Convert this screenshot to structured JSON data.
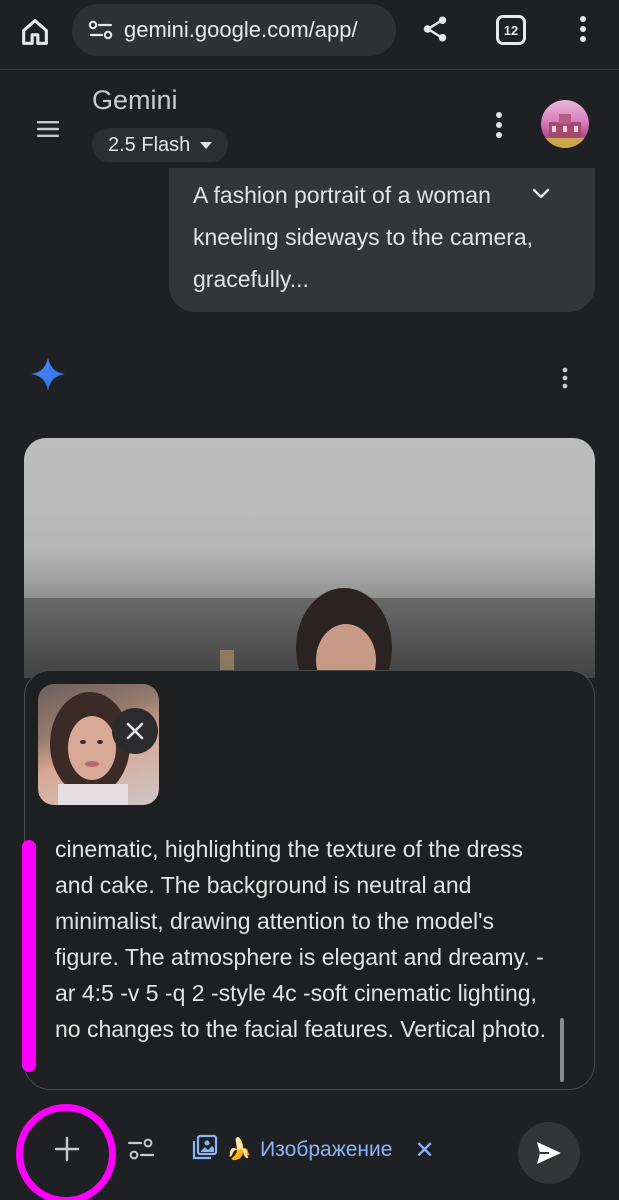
{
  "browser": {
    "url": "gemini.google.com/app/",
    "tab_count": "12"
  },
  "header": {
    "title": "Gemini",
    "model": "2.5 Flash"
  },
  "conversation": {
    "user_prompt": "A fashion portrait of a woman kneeling sideways to the camera, gracefully..."
  },
  "composer": {
    "text": "cinematic, highlighting the texture of the dress and cake. The background is neutral and minimalist, drawing attention to the model's figure. The atmosphere is elegant and dreamy. - ar 4:5 -v 5 -q 2 -style 4c -soft cinematic lighting, no changes to the facial features. Vertical photo."
  },
  "toolbar": {
    "chip_emoji": "🍌",
    "chip_label": "Изображение",
    "chip_close": "✕"
  },
  "colors": {
    "accent": "#8ab4f8",
    "annotation": "#ff00ff",
    "background": "#1f2023"
  }
}
